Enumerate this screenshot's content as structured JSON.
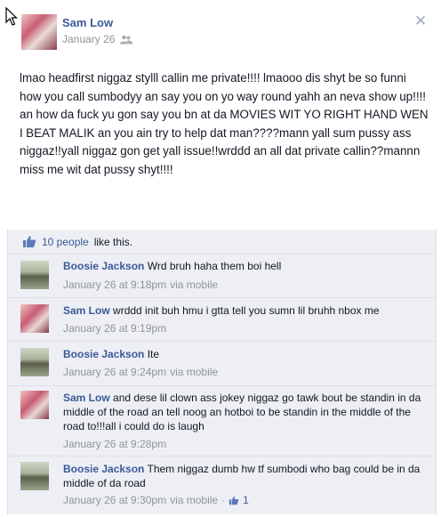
{
  "post": {
    "author": "Sam Low",
    "date": "January 26",
    "body": "lmao headfirst niggaz stylll callin me private!!!! lmaooo dis shyt be so funni how you call sumbodyy an say you on yo way round yahh an neva show up!!!! an how da fuck yu gon say you bn at da MOVIES WIT YO RIGHT HAND WEN I BEAT MALIK an you ain try to help dat man????mann yall sum pussy ass niggaz!!yall niggaz gon get yall issue!!wrddd an all dat private callin??mannn miss me wit dat pussy shyt!!!!"
  },
  "likes": {
    "count_text": "10 people",
    "suffix": "like this."
  },
  "comments": [
    {
      "author": "Boosie Jackson",
      "text": "Wrd bruh haha them boi hell",
      "time": "January 26 at 9:18pm",
      "via": "via mobile"
    },
    {
      "author": "Sam Low",
      "text": "wrddd init buh hmu i gtta tell you sumn lil bruhh nbox me",
      "time": "January 26 at 9:19pm",
      "via": ""
    },
    {
      "author": "Boosie Jackson",
      "text": "Ite",
      "time": "January 26 at 9:24pm",
      "via": "via mobile"
    },
    {
      "author": "Sam Low",
      "text": "and dese lil clown ass jokey niggaz go tawk bout be standin in da middle of the road an tell noog an hotboi to be standin in the middle of the road to!!!all i could do is laugh",
      "time": "January 26 at 9:28pm",
      "via": ""
    },
    {
      "author": "Boosie Jackson",
      "text": "Them niggaz dumb hw tf sumbodi who bag could be in da middle of da road",
      "time": "January 26 at 9:30pm",
      "via": "via mobile",
      "dot": "·",
      "likes": "1"
    }
  ],
  "icons": {
    "close": "close-icon",
    "audience": "friends-audience-icon",
    "like": "thumbs-up-icon",
    "cursor": "mouse-cursor-icon"
  },
  "colors": {
    "link": "#3b5998",
    "meta": "#90949c",
    "feedback_bg": "#edeff4"
  }
}
